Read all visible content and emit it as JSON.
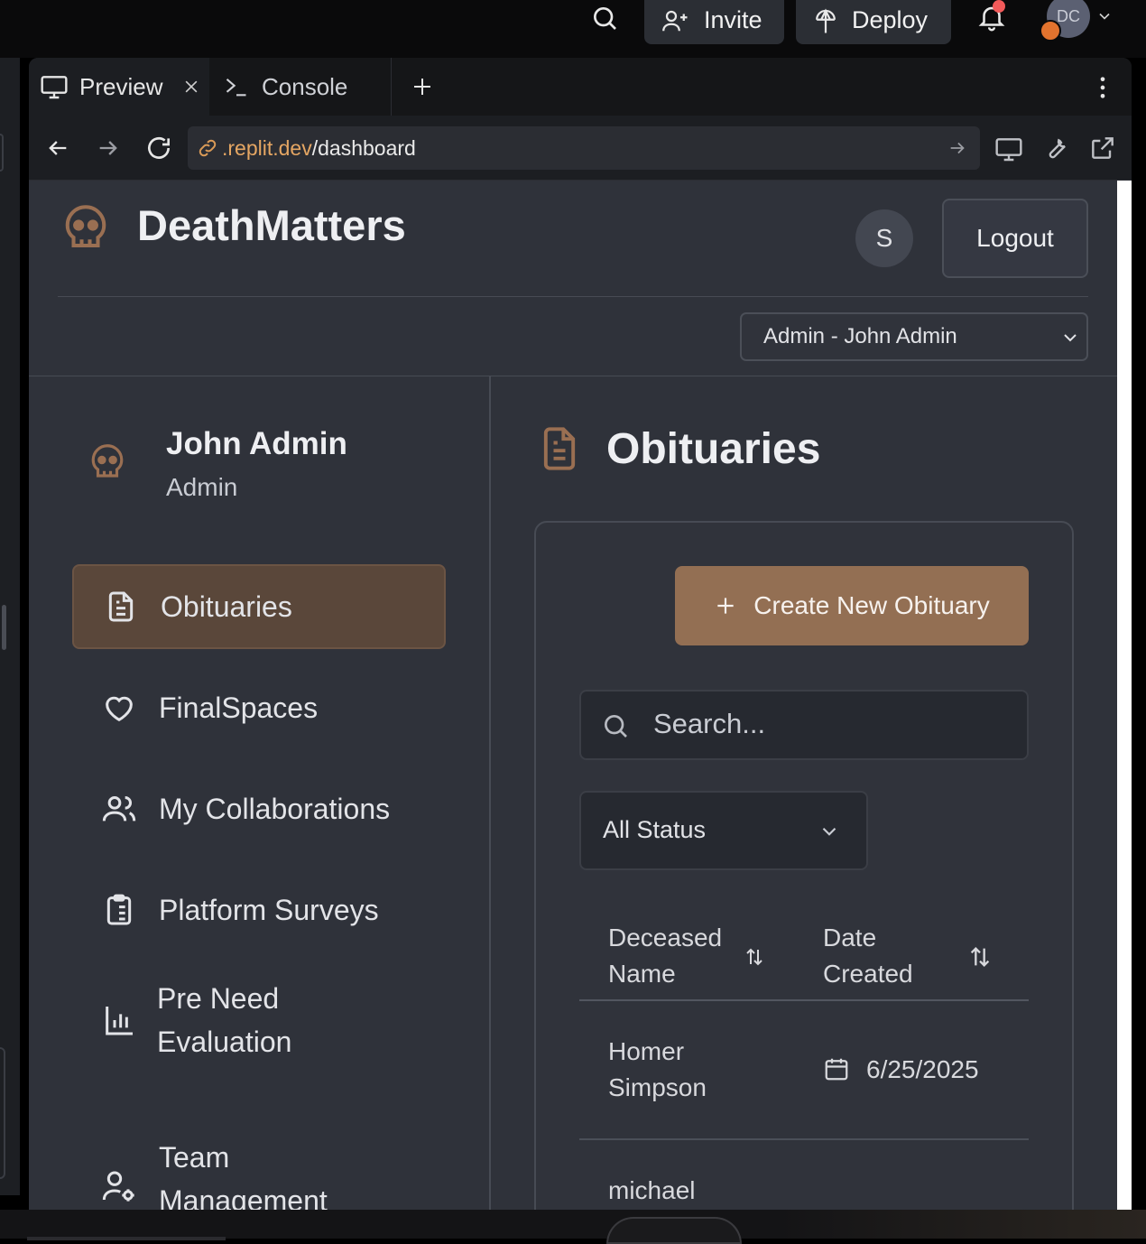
{
  "topbar": {
    "invite_label": "Invite",
    "deploy_label": "Deploy",
    "avatar_initials": "DC"
  },
  "browser": {
    "tabs": [
      {
        "label": "Preview"
      },
      {
        "label": "Console"
      }
    ],
    "url_host": ".replit.dev",
    "url_path": "/dashboard"
  },
  "app": {
    "brand": "DeathMatters",
    "user_avatar_letter": "S",
    "logout_label": "Logout",
    "role_select_value": "Admin - John Admin",
    "colors": {
      "accent": "#936f53",
      "active_nav_bg": "#5a473a",
      "bg": "#2f323a"
    }
  },
  "sidebar": {
    "user_name": "John Admin",
    "user_role": "Admin",
    "items": [
      {
        "label": "Obituaries",
        "icon": "document-icon",
        "active": true
      },
      {
        "label": "FinalSpaces",
        "icon": "heart-icon"
      },
      {
        "label": "My Collaborations",
        "icon": "users-icon"
      },
      {
        "label": "Platform Surveys",
        "icon": "clipboard-icon"
      },
      {
        "label": "Pre Need Evaluation",
        "icon": "bar-chart-icon"
      },
      {
        "label": "Team Management",
        "icon": "user-gear-icon"
      }
    ]
  },
  "main": {
    "title": "Obituaries",
    "create_button_label": "Create New Obituary",
    "search_placeholder": "Search...",
    "status_filter_value": "All Status",
    "table": {
      "columns": [
        "Deceased Name",
        "Date Created"
      ],
      "rows": [
        {
          "name": "Homer Simpson",
          "date": "6/25/2025"
        },
        {
          "name": "michael",
          "date": ""
        }
      ]
    }
  }
}
